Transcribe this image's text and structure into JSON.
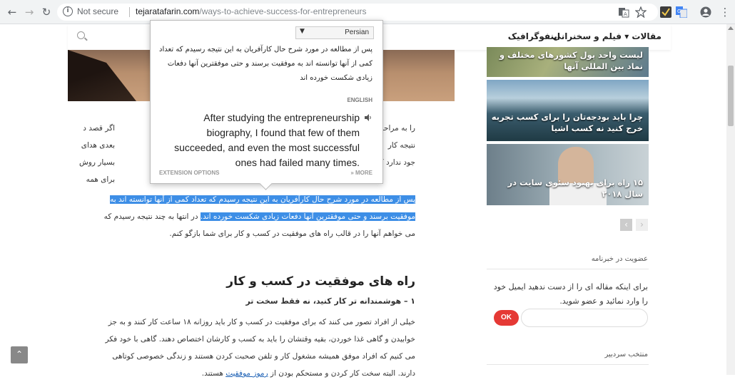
{
  "browser": {
    "security_label": "Not secure",
    "url_host": "tejaratafarin.com",
    "url_path": "/ways-to-achieve-success-for-entrepreneurs"
  },
  "site_nav": {
    "items": [
      "مقالات",
      "فیلم و سخنرانی",
      "اینفوگرافیک"
    ]
  },
  "article": {
    "para1": [
      "اگر قصد د",
      "بعدی هدای",
      "بسیار روش",
      "برای همه"
    ],
    "para1_right": [
      "را به مراحل",
      "نتیجه کار",
      "جود ندارد که"
    ],
    "highlight_line1": "پس از مطالعه در مورد شرح حال کارآفریان به این نتیجه رسیدم که تعداد کمی از آنها توانسته اند به",
    "highlight_line2a": "موفقیت برسند و حتی موفقترین آنها دفعات زیادی شکست خورده اند.",
    "highlight_line2b": " در انتها به چند نتیجه رسیدم که",
    "line3": "می خواهم آنها را در قالب راه های موفقیت در کسب و کار برای شما بازگو کنم.",
    "section_title": "راه های موفقیت در کسب و کار",
    "subheading": "۱ – هوشمندانه تر کار کنید، نه فقط سخت تر",
    "para2": [
      "خیلی از افراد تصور می کنند که برای موفقیت در کسب و کار باید روزانه ۱۸ ساعت کار کنند و به جز",
      "خوابیدن و گاهی غذا خوردن، بقیه وقتشان را باید به کسب و کارشان اختصاص دهند. گاهی با خود فکر",
      "می کنیم که افراد موفق همیشه مشغول کار و تلفن صحبت کردن هستند و زندگی خصوصی کوتاهی",
      "دارند. البته سخت کار کردن و مستحکم بودن از "
    ],
    "para2_link": "رموز موفقیت",
    "para2_end": " هستند."
  },
  "translate_popup": {
    "language": "Persian",
    "source_text": "پس از مطالعه در مورد شرح حال کارآفریان به این نتیجه رسیدم که تعداد کمی از آنها توانسته اند به موفقیت برسند و حتی موفقترین آنها دفعات زیادی شکست خورده اند",
    "target_label": "ENGLISH",
    "translation": "After studying the entrepreneurship biography, I found that few of them succeeded, and even the most successful ones had failed many times.",
    "options_label": "EXTENSION OPTIONS",
    "more_label": "» MORE"
  },
  "sidebar": {
    "cards": [
      "لیست واحد پول کشورهای مختلف و نماد بین المللی آنها",
      "چرا باید بودجه‌تان را برای کسب تجربه خرج کنید نه کسب اشیا",
      "۱۵ راه برای بهبود سئوی سایت در سال ۲۰۱۸"
    ],
    "newsletter_title": "عضویت در خبرنامه",
    "newsletter_text": "برای اینکه مقاله ای را از دست ندهید ایمیل خود را وارد نمائید و عضو شوید.",
    "ok_label": "OK",
    "featured_title": "منتخب سردبیر"
  },
  "colors": {
    "highlight": "#3d8ee6",
    "ok_button": "#e53935",
    "link": "#1a5fb4"
  }
}
